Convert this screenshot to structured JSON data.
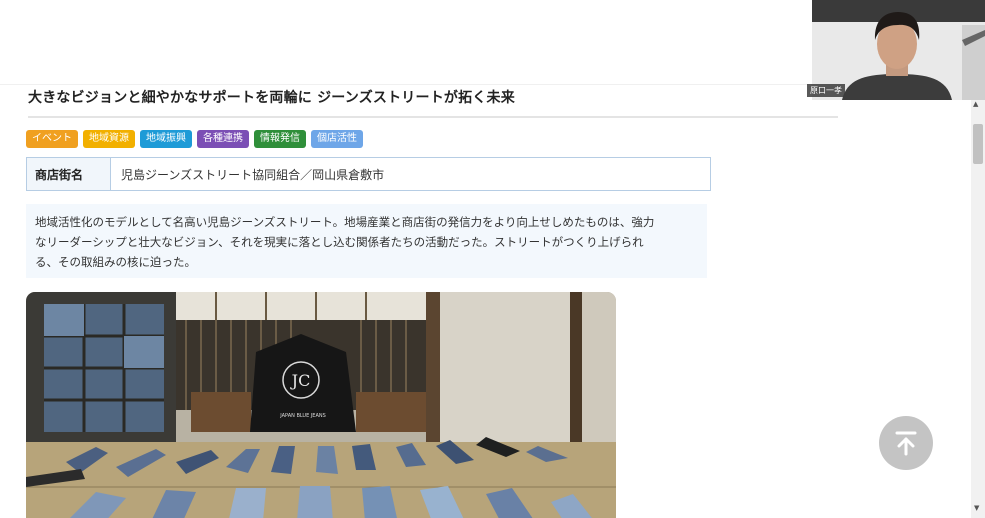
{
  "article": {
    "title": "大きなビジョンと細やかなサポートを両輪に ジーンズストリートが拓く未来",
    "tags": [
      {
        "label": "イベント",
        "color": "#f0a020"
      },
      {
        "label": "地域資源",
        "color": "#f2b000"
      },
      {
        "label": "地域振興",
        "color": "#1e9bd7"
      },
      {
        "label": "各種連携",
        "color": "#7b4fb5"
      },
      {
        "label": "情報発信",
        "color": "#2f8f3a"
      },
      {
        "label": "個店活性",
        "color": "#6ea6e8"
      }
    ],
    "info": {
      "label": "商店街名",
      "value": "児島ジーンズストリート協同組合／岡山県倉敷市"
    },
    "summary_lines": [
      "地域活性化のモデルとして名高い児島ジーンズストリート。地場産業と商店街の発信力をより向上せしめたものは、強力",
      "なリーダーシップと壮大なビジョン、それを現実に落とし込む関係者たちの活動だった。ストリートがつくり上げられ",
      "る、その取組みの核に迫った。"
    ],
    "photo": {
      "bag_text": "JAPAN BLUE JEANS"
    }
  },
  "video": {
    "participant_name": "原口一孝"
  },
  "ui": {
    "back_to_top_icon": "arrow-up-to-top-icon",
    "scroll_up_icon": "triangle-up-icon",
    "scroll_down_icon": "triangle-down-icon"
  }
}
